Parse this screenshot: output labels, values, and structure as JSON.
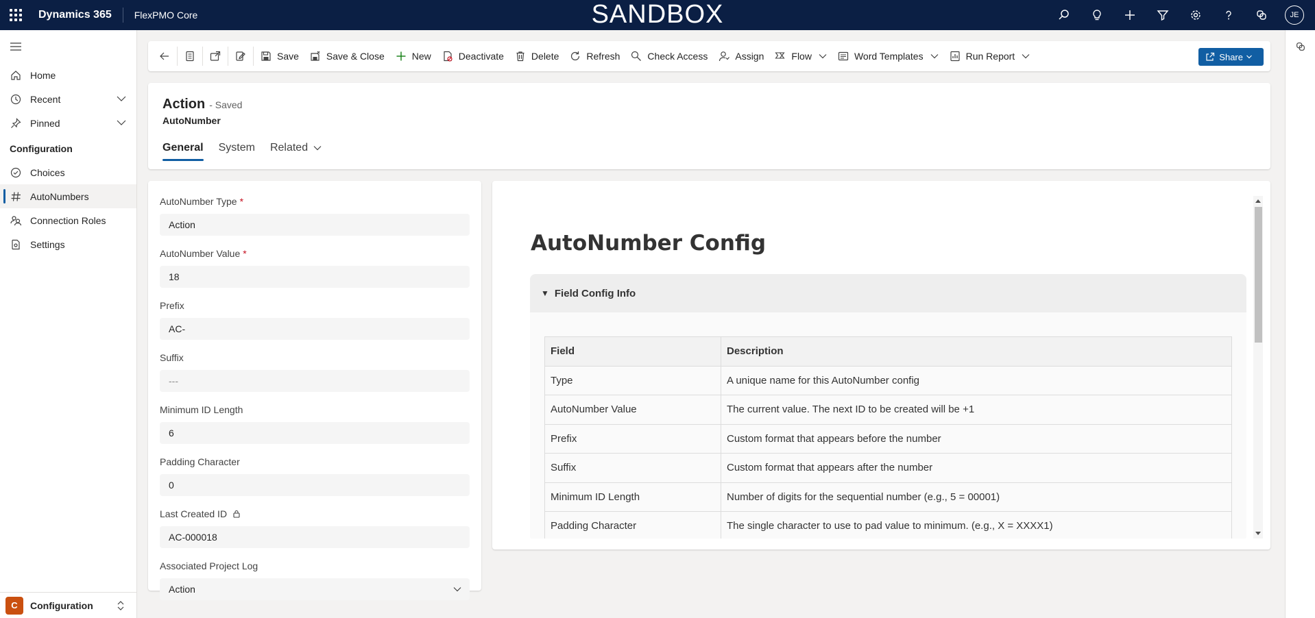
{
  "topbar": {
    "brand": "Dynamics 365",
    "app_name": "FlexPMO Core",
    "environment_banner": "SANDBOX",
    "icons": [
      "search-icon",
      "lightbulb-icon",
      "plus-icon",
      "filter-icon",
      "gear-icon",
      "help-icon",
      "copilot-icon"
    ],
    "user_initials": "JE"
  },
  "sidebar": {
    "items": [
      {
        "label": "Home",
        "icon": "home-icon"
      },
      {
        "label": "Recent",
        "icon": "clock-icon"
      },
      {
        "label": "Pinned",
        "icon": "pin-icon"
      }
    ],
    "section_label": "Configuration",
    "section_items": [
      {
        "label": "Choices",
        "icon": "check-circle-icon"
      },
      {
        "label": "AutoNumbers",
        "icon": "hash-icon",
        "active": true
      },
      {
        "label": "Connection Roles",
        "icon": "people-icon"
      },
      {
        "label": "Settings",
        "icon": "settings-icon"
      }
    ],
    "area_badge": "C",
    "area_label": "Configuration"
  },
  "commandbar": {
    "save": "Save",
    "save_close": "Save & Close",
    "new": "New",
    "deactivate": "Deactivate",
    "delete": "Delete",
    "refresh": "Refresh",
    "check_access": "Check Access",
    "assign": "Assign",
    "flow": "Flow",
    "word_templates": "Word Templates",
    "run_report": "Run Report",
    "share": "Share"
  },
  "record": {
    "title": "Action",
    "status": "- Saved",
    "entity": "AutoNumber",
    "tabs": [
      "General",
      "System",
      "Related"
    ]
  },
  "form": {
    "fields": [
      {
        "label": "AutoNumber Type",
        "required": true,
        "value": "Action"
      },
      {
        "label": "AutoNumber Value",
        "required": true,
        "value": "18"
      },
      {
        "label": "Prefix",
        "value": "AC-"
      },
      {
        "label": "Suffix",
        "value": "---"
      },
      {
        "label": "Minimum ID Length",
        "value": "6"
      },
      {
        "label": "Padding Character",
        "value": "0"
      },
      {
        "label": "Last Created ID",
        "locked": true,
        "value": "AC-000018"
      },
      {
        "label": "Associated Project Log",
        "value": "Action"
      }
    ],
    "required_marker": "*"
  },
  "config": {
    "title": "AutoNumber Config",
    "summary": "Field Config Info",
    "headers": [
      "Field",
      "Description"
    ],
    "rows": [
      [
        "Type",
        "A unique name for this AutoNumber config"
      ],
      [
        "AutoNumber Value",
        "The current value. The next ID to be created will be +1"
      ],
      [
        "Prefix",
        "Custom format that appears before the number"
      ],
      [
        "Suffix",
        "Custom format that appears after the number"
      ],
      [
        "Minimum ID Length",
        "Number of digits for the sequential number (e.g., 5 = 00001)"
      ],
      [
        "Padding Character",
        "The single character to use to pad value to minimum. (e.g., X = XXXX1)"
      ]
    ]
  },
  "colors": {
    "topbar": "#0b1f44",
    "accent": "#115ea3",
    "area_badge": "#ca5010",
    "required": "#c50f1f"
  }
}
